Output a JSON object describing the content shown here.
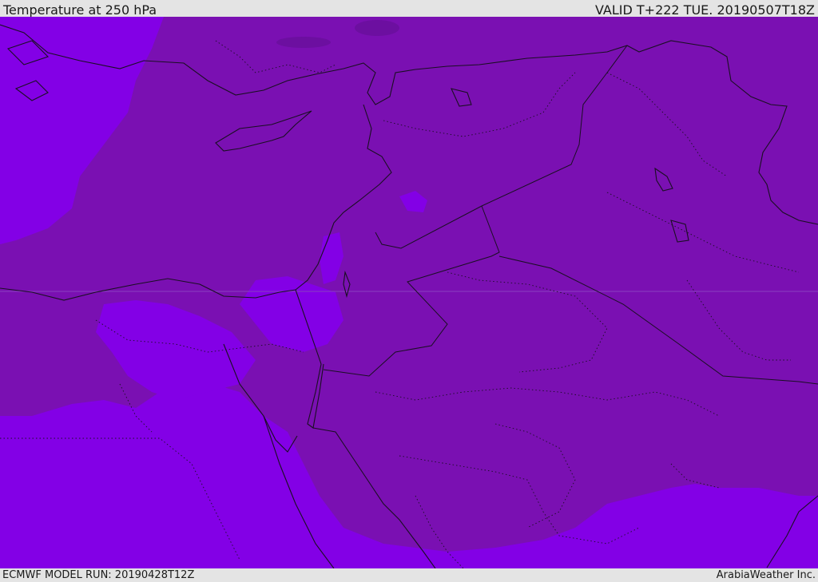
{
  "header": {
    "title": "Temperature at 250 hPa",
    "valid": "VALID T+222 TUE. 20190507T18Z"
  },
  "footer": {
    "model_run": "ECMWF MODEL RUN: 20190428T12Z",
    "credit": "ArabiaWeather Inc."
  },
  "colors": {
    "band_dark": "#7a10b2",
    "band_bright": "#8300e6",
    "band_deep": "#6c0fa0",
    "border_line": "#1a0f22",
    "bar_background": "#e4e4e4"
  }
}
